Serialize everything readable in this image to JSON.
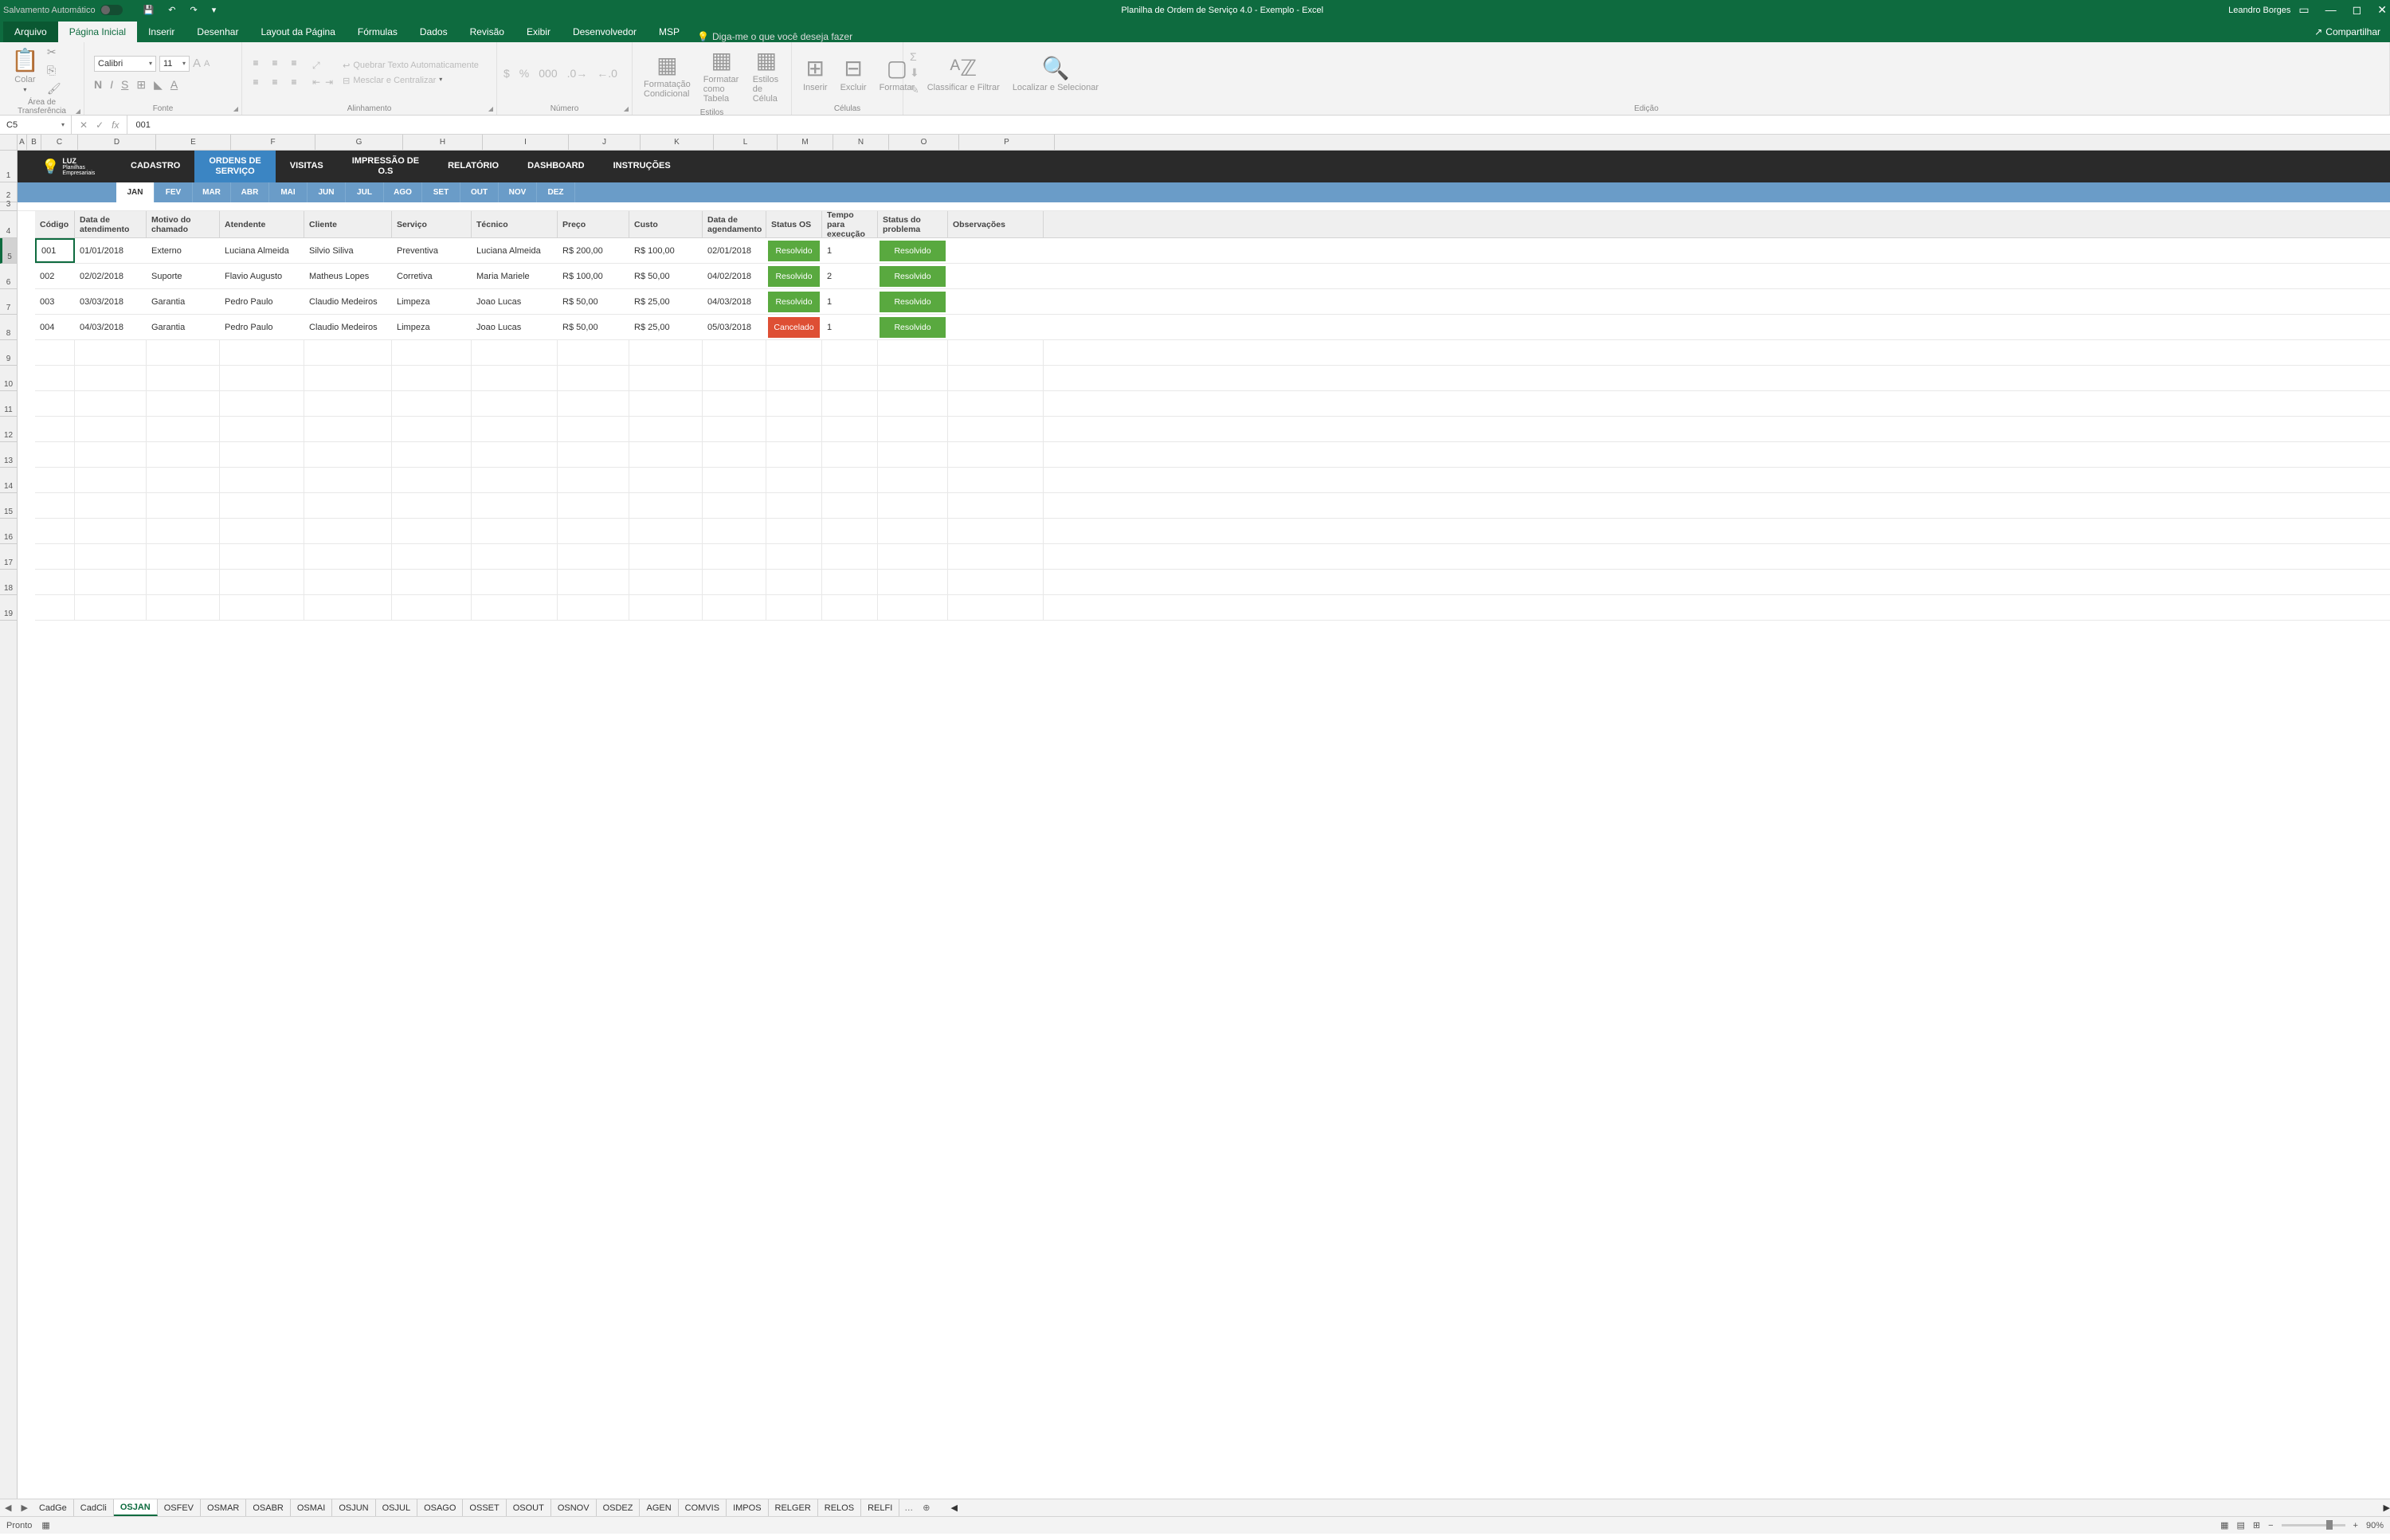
{
  "titlebar": {
    "autosave": "Salvamento Automático",
    "title": "Planilha de Ordem de Serviço 4.0 - Exemplo  -  Excel",
    "user": "Leandro Borges"
  },
  "tabs": {
    "file": "Arquivo",
    "home": "Página Inicial",
    "insert": "Inserir",
    "draw": "Desenhar",
    "layout": "Layout da Página",
    "formulas": "Fórmulas",
    "data": "Dados",
    "review": "Revisão",
    "view": "Exibir",
    "dev": "Desenvolvedor",
    "msp": "MSP",
    "tellme": "Diga-me o que você deseja fazer",
    "share": "Compartilhar"
  },
  "ribbon": {
    "paste": "Colar",
    "clip": "Área de Transferência",
    "font": "Fonte",
    "align": "Alinhamento",
    "number": "Número",
    "styles": "Estilos",
    "cells": "Células",
    "edit": "Edição",
    "fontname": "Calibri",
    "fontsize": "11",
    "wrap": "Quebrar Texto Automaticamente",
    "merge": "Mesclar e Centralizar",
    "condfmt": "Formatação Condicional",
    "tblefmt": "Formatar como Tabela",
    "cellstyle": "Estilos de Célula",
    "ins": "Inserir",
    "del": "Excluir",
    "fmt": "Formatar",
    "sort": "Classificar e Filtrar",
    "find": "Localizar e Selecionar"
  },
  "fbar": {
    "name": "C5",
    "val": "001"
  },
  "cols": [
    "A",
    "B",
    "C",
    "D",
    "E",
    "F",
    "G",
    "H",
    "I",
    "J",
    "K",
    "L",
    "M",
    "N",
    "O",
    "P"
  ],
  "rows": [
    "1",
    "2",
    "3",
    "4",
    "5",
    "6",
    "7",
    "8",
    "9",
    "10",
    "11",
    "12",
    "13",
    "14",
    "15",
    "16",
    "17",
    "18",
    "19"
  ],
  "nav": {
    "logo": "LUZ",
    "logosub": "Planilhas Empresariais",
    "items": [
      "CADASTRO",
      "ORDENS DE SERVIÇO",
      "VISITAS",
      "IMPRESSÃO DE O.S",
      "RELATÓRIO",
      "DASHBOARD",
      "INSTRUÇÕES"
    ]
  },
  "months": [
    "JAN",
    "FEV",
    "MAR",
    "ABR",
    "MAI",
    "JUN",
    "JUL",
    "AGO",
    "SET",
    "OUT",
    "NOV",
    "DEZ"
  ],
  "headers": {
    "codigo": "Código",
    "data_at": "Data de atendimento",
    "motivo": "Motivo do chamado",
    "atend": "Atendente",
    "cli": "Cliente",
    "serv": "Serviço",
    "tec": "Técnico",
    "preco": "Preço",
    "custo": "Custo",
    "agen": "Data de agendamento",
    "status": "Status OS",
    "tempo": "Tempo para execução",
    "prob": "Status do problema",
    "obs": "Observações"
  },
  "data": [
    {
      "c": "001",
      "dt": "01/01/2018",
      "mot": "Externo",
      "at": "Luciana Almeida",
      "cl": "Silvio Siliva",
      "sv": "Preventiva",
      "tc": "Luciana Almeida",
      "pr": "R$ 200,00",
      "cu": "R$ 100,00",
      "ag": "02/01/2018",
      "st": "Resolvido",
      "stc": "green",
      "te": "1",
      "pb": "Resolvido",
      "pbc": "green"
    },
    {
      "c": "002",
      "dt": "02/02/2018",
      "mot": "Suporte",
      "at": "Flavio Augusto",
      "cl": "Matheus Lopes",
      "sv": "Corretiva",
      "tc": "Maria Mariele",
      "pr": "R$ 100,00",
      "cu": "R$ 50,00",
      "ag": "04/02/2018",
      "st": "Resolvido",
      "stc": "green",
      "te": "2",
      "pb": "Resolvido",
      "pbc": "green"
    },
    {
      "c": "003",
      "dt": "03/03/2018",
      "mot": "Garantia",
      "at": "Pedro Paulo",
      "cl": "Claudio Medeiros",
      "sv": "Limpeza",
      "tc": "Joao Lucas",
      "pr": "R$ 50,00",
      "cu": "R$ 25,00",
      "ag": "04/03/2018",
      "st": "Resolvido",
      "stc": "green",
      "te": "1",
      "pb": "Resolvido",
      "pbc": "green"
    },
    {
      "c": "004",
      "dt": "04/03/2018",
      "mot": "Garantia",
      "at": "Pedro Paulo",
      "cl": "Claudio Medeiros",
      "sv": "Limpeza",
      "tc": "Joao Lucas",
      "pr": "R$ 50,00",
      "cu": "R$ 25,00",
      "ag": "05/03/2018",
      "st": "Cancelado",
      "stc": "red",
      "te": "1",
      "pb": "Resolvido",
      "pbc": "green"
    }
  ],
  "sheets": [
    "CadGe",
    "CadCli",
    "OSJAN",
    "OSFEV",
    "OSMAR",
    "OSABR",
    "OSMAI",
    "OSJUN",
    "OSJUL",
    "OSAGO",
    "OSSET",
    "OSOUT",
    "OSNOV",
    "OSDEZ",
    "AGEN",
    "COMVIS",
    "IMPOS",
    "RELGER",
    "RELOS",
    "RELFI"
  ],
  "activeSheet": "OSJAN",
  "status": {
    "ready": "Pronto",
    "zoom": "90%"
  }
}
